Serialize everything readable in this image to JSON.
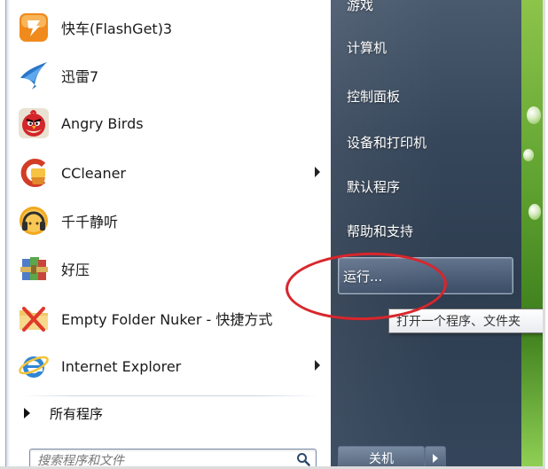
{
  "left_panel": {
    "programs": [
      {
        "label": "快车(FlashGet)3",
        "icon": "flashget-icon",
        "has_submenu": false
      },
      {
        "label": "迅雷7",
        "icon": "thunder-bird-icon",
        "has_submenu": false
      },
      {
        "label": "Angry Birds",
        "icon": "angry-bird-icon",
        "has_submenu": false
      },
      {
        "label": "CCleaner",
        "icon": "ccleaner-icon",
        "has_submenu": true
      },
      {
        "label": "千千静听",
        "icon": "ttplayer-headphones-icon",
        "has_submenu": false
      },
      {
        "label": "好压",
        "icon": "haozip-archive-icon",
        "has_submenu": false
      },
      {
        "label": "Empty Folder Nuker - 快捷方式",
        "icon": "empty-folder-nuker-icon",
        "has_submenu": false
      },
      {
        "label": "Internet Explorer",
        "icon": "internet-explorer-icon",
        "has_submenu": true
      }
    ],
    "all_programs_label": "所有程序",
    "search_placeholder": "搜索程序和文件"
  },
  "right_panel": {
    "links": [
      {
        "label": "游戏"
      },
      {
        "label": "计算机"
      },
      {
        "label": "控制面板"
      },
      {
        "label": "设备和打印机"
      },
      {
        "label": "默认程序"
      },
      {
        "label": "帮助和支持"
      },
      {
        "label": "运行..."
      }
    ],
    "shutdown_label": "关机"
  },
  "tooltip": {
    "text": "打开一个程序、文件夹"
  },
  "colors": {
    "right_pane": "#36465a",
    "annotation": "#d8262c",
    "wallpaper": "#5fa230"
  }
}
